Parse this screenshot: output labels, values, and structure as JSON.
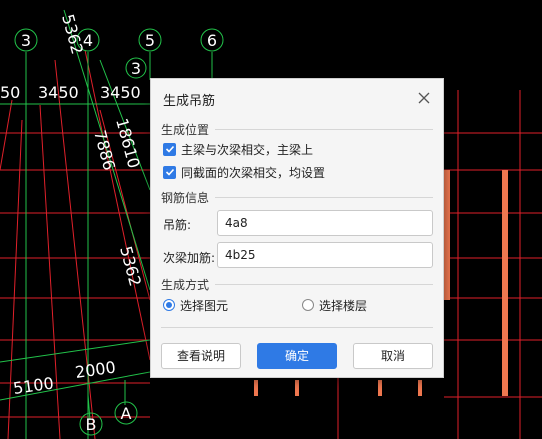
{
  "cad": {
    "axis_labels": [
      "3",
      "4",
      "5",
      "6",
      "3",
      "B",
      "A"
    ],
    "dims": [
      "50",
      "3450",
      "3450",
      "5362",
      "7886",
      "18610",
      "5362",
      "5100",
      "2000"
    ]
  },
  "dialog": {
    "title": "生成吊筋",
    "close_icon": "close-icon",
    "position_section": "生成位置",
    "option1": "主梁与次梁相交，主梁上",
    "option2": "同截面的次梁相交，均设置",
    "rebar_section": "钢筋信息",
    "hanger_label": "吊筋:",
    "hanger_value": "4a8",
    "secondary_label": "次梁加筋:",
    "secondary_value": "4b25",
    "method_section": "生成方式",
    "radio1": "选择图元",
    "radio2": "选择楼层",
    "btn_help": "查看说明",
    "btn_ok": "确定",
    "btn_cancel": "取消",
    "accent": "#2f7ae5"
  }
}
